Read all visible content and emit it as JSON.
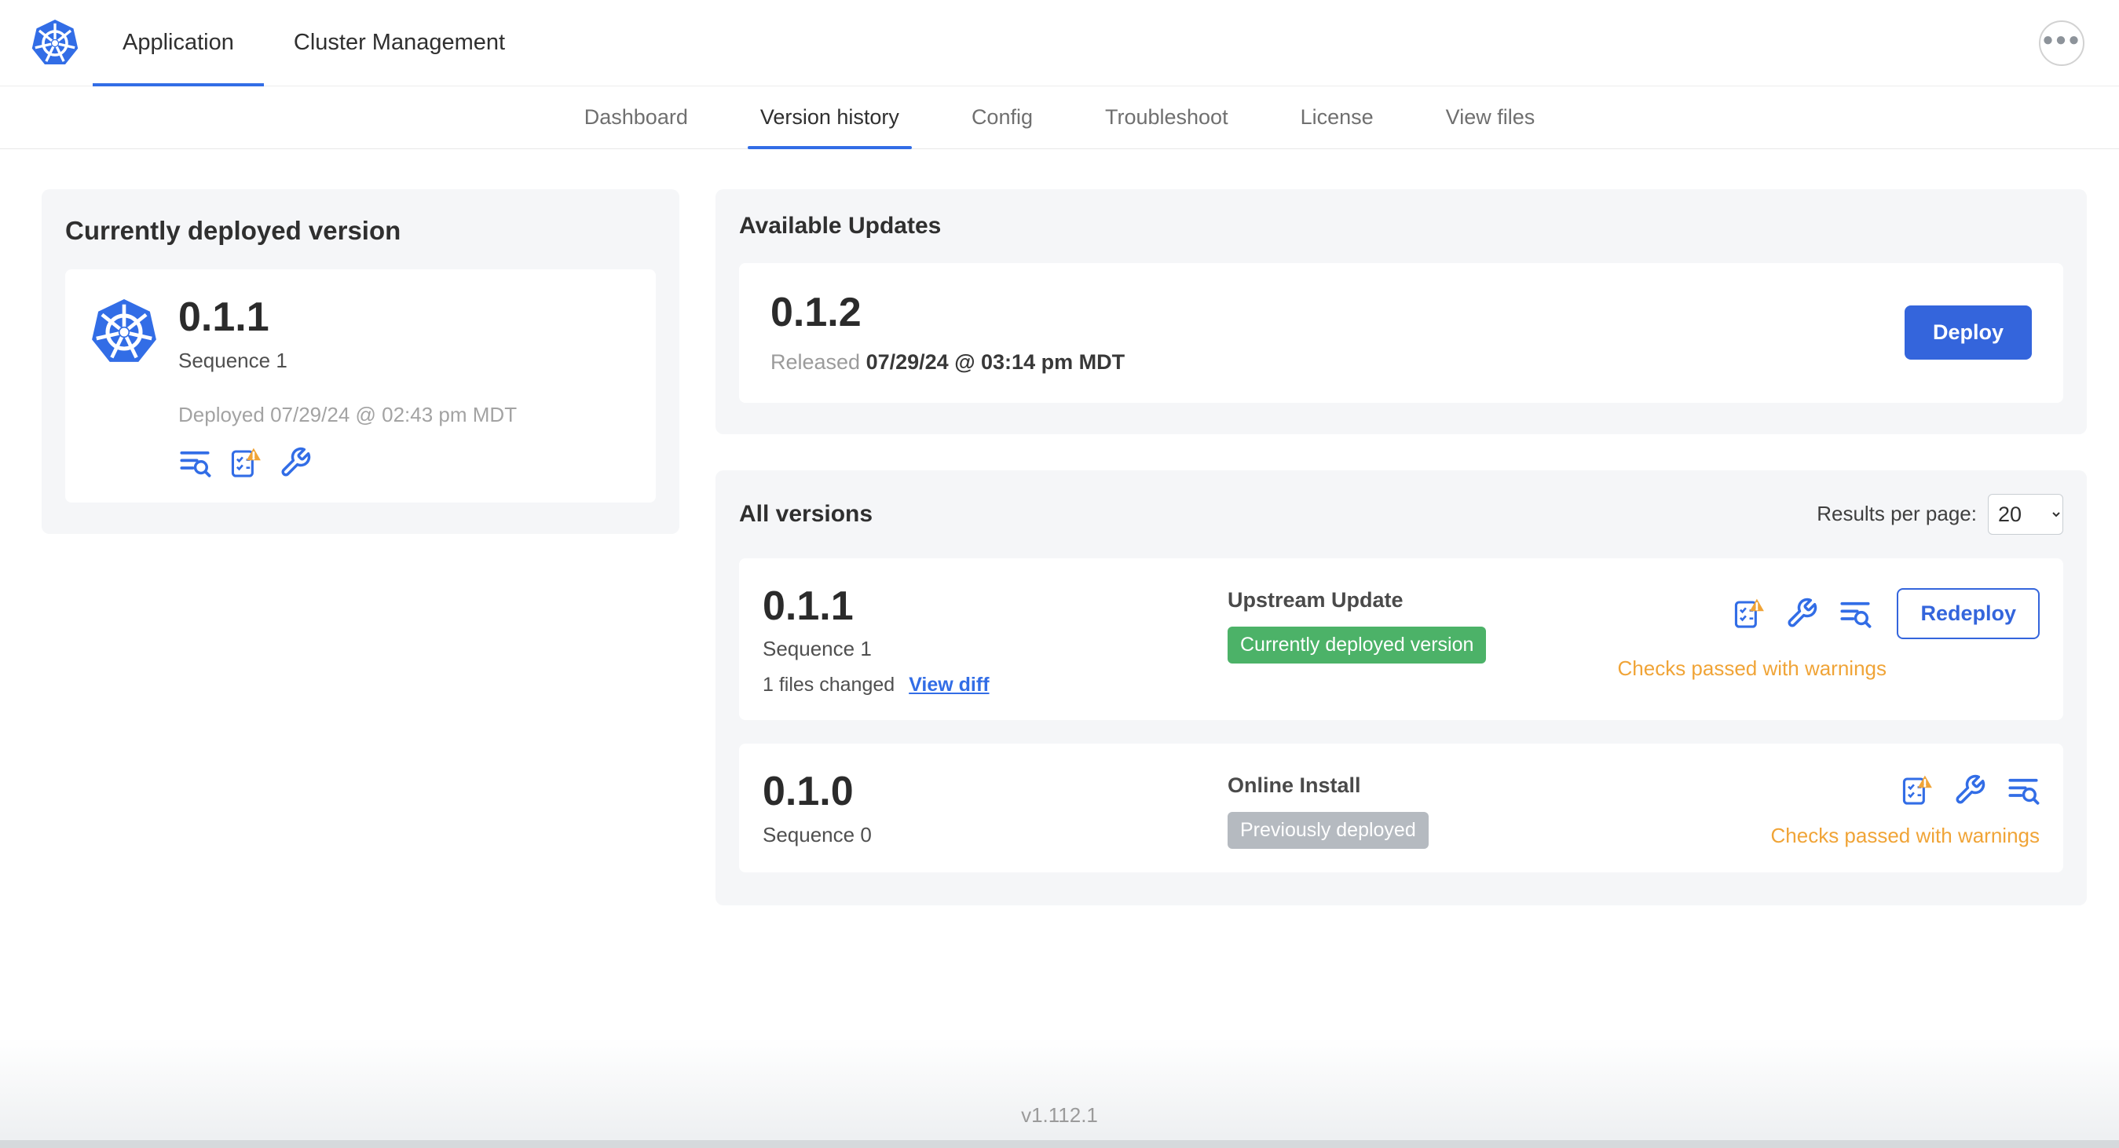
{
  "colors": {
    "accent_blue": "#326de6",
    "button_blue": "#3465dc",
    "badge_green": "#4cb268",
    "badge_gray": "#b5bac0",
    "warning_orange": "#f0a437"
  },
  "icons": {
    "app_logo": "kubernetes-logo",
    "more_menu": "ellipsis-icon",
    "logs": "logs-icon",
    "preflight": "preflight-checks-icon",
    "config": "config-icon",
    "warning": "warning-triangle-icon"
  },
  "topnav": {
    "tabs": [
      {
        "label": "Application",
        "active": true
      },
      {
        "label": "Cluster Management",
        "active": false
      }
    ]
  },
  "subnav": {
    "items": [
      {
        "label": "Dashboard",
        "active": false
      },
      {
        "label": "Version history",
        "active": true
      },
      {
        "label": "Config",
        "active": false
      },
      {
        "label": "Troubleshoot",
        "active": false
      },
      {
        "label": "License",
        "active": false
      },
      {
        "label": "View files",
        "active": false
      }
    ]
  },
  "deployed_card": {
    "title": "Currently deployed version",
    "version": "0.1.1",
    "sequence": "Sequence 1",
    "deployed_at": "Deployed 07/29/24 @ 02:43 pm MDT"
  },
  "available_updates": {
    "title": "Available Updates",
    "version": "0.1.2",
    "released_label": "Released",
    "released_date": "07/29/24 @ 03:14 pm MDT",
    "deploy_button": "Deploy"
  },
  "all_versions": {
    "title": "All versions",
    "results_label": "Results per page:",
    "results_value": "20",
    "rows": [
      {
        "version": "0.1.1",
        "sequence": "Sequence 1",
        "files_changed": "1 files changed",
        "view_diff": "View diff",
        "source": "Upstream Update",
        "badge": "Currently deployed version",
        "status": "Checks passed with warnings",
        "action": "Redeploy"
      },
      {
        "version": "0.1.0",
        "sequence": "Sequence 0",
        "source": "Online Install",
        "badge": "Previously deployed",
        "status": "Checks passed with warnings"
      }
    ]
  },
  "footer": {
    "version": "v1.112.1"
  }
}
